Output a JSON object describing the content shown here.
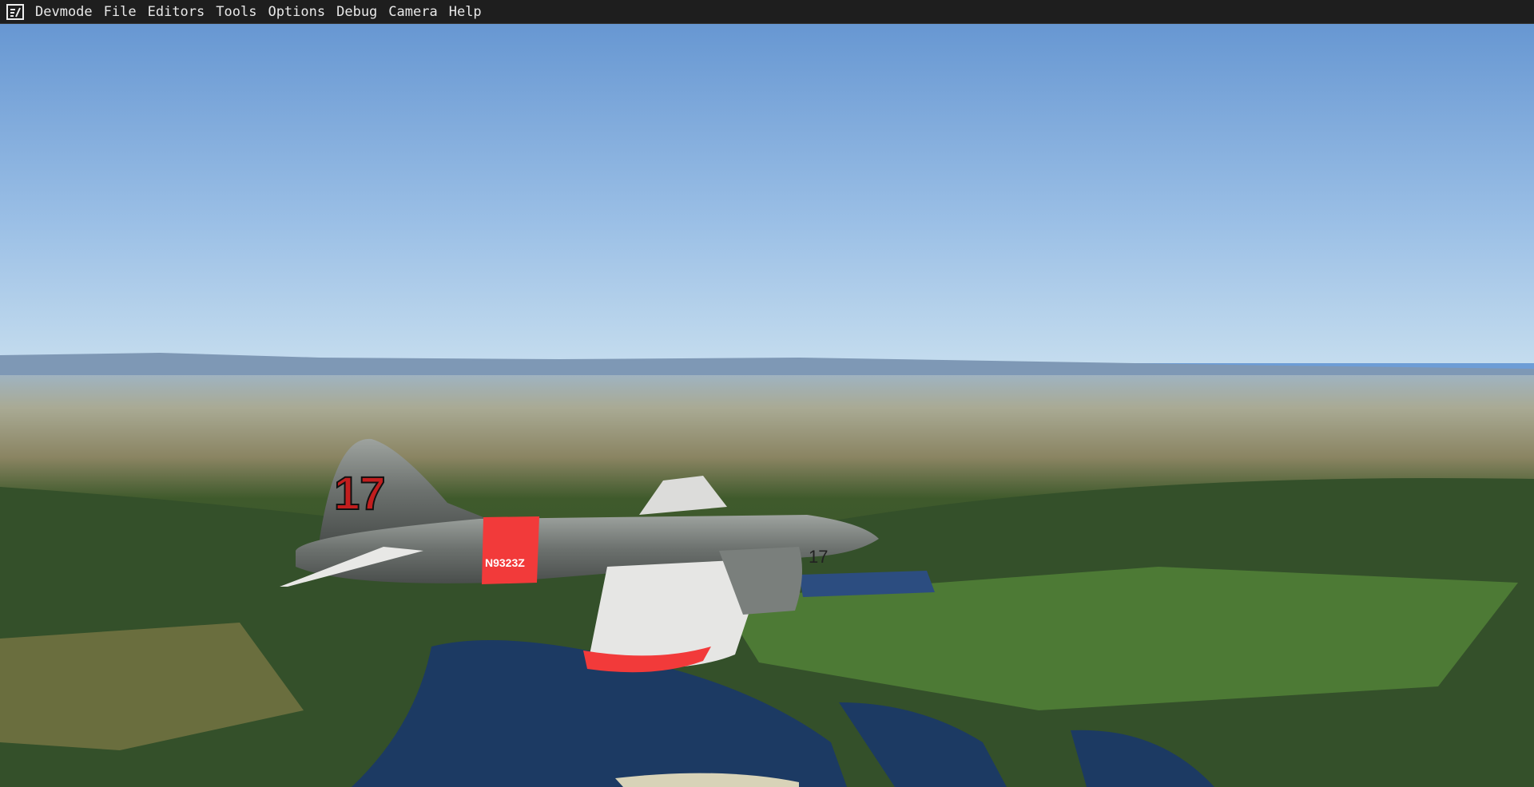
{
  "menubar": {
    "icon": "devmode-logo-icon",
    "items": [
      "Devmode",
      "File",
      "Editors",
      "Tools",
      "Options",
      "Debug",
      "Camera",
      "Help"
    ]
  },
  "scene": {
    "aircraft_tail_number": "17",
    "aircraft_registration": "N9323Z",
    "nose_number": "17"
  },
  "colors": {
    "menu_bg": "#1e1e1e",
    "sky_top": "#6797d2",
    "sky_horizon": "#bcd6ec",
    "accent_red": "#f23a3a"
  }
}
